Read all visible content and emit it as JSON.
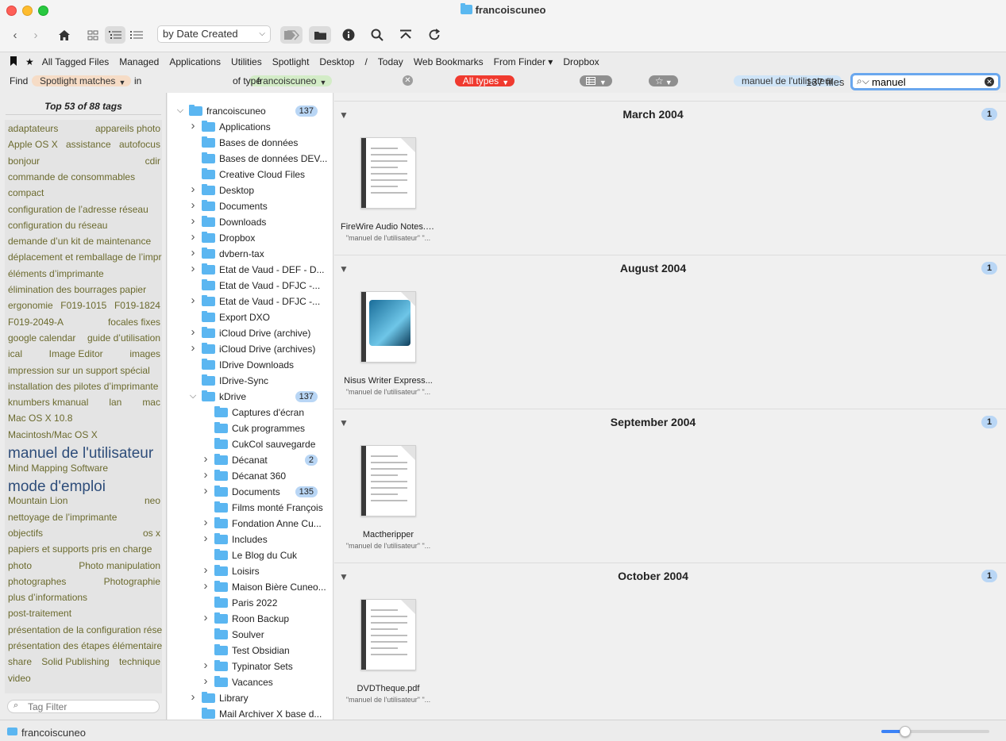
{
  "window": {
    "title": "francoiscuneo"
  },
  "toolbar": {
    "sort_label": "by Date Created",
    "icons": [
      "back-icon",
      "forward-icon",
      "home-icon",
      "grid-view-icon",
      "list-view-icon",
      "compact-list-icon",
      "tag-icon",
      "folder-icon",
      "info-icon",
      "search-icon",
      "go-top-icon",
      "refresh-icon"
    ]
  },
  "favorites": [
    "All Tagged Files",
    "Managed",
    "Applications",
    "Utilities",
    "Spotlight",
    "Desktop",
    "/",
    "Today",
    "Web Bookmarks",
    "From Finder ▾",
    "Dropbox"
  ],
  "findbar": {
    "find_label": "Find",
    "mode": "Spotlight matches",
    "in_label": "in",
    "location": "francoiscuneo",
    "type_label": "of type",
    "types": "All types",
    "tag_chip": "manuel de l'utilisateur",
    "count": "137 files"
  },
  "search": {
    "value": "manuel"
  },
  "tags": {
    "header": "Top 53 of 88 tags",
    "rows": [
      [
        "adaptateurs",
        "appareils photo"
      ],
      [
        "Apple OS X",
        "assistance",
        "autofocus"
      ],
      [
        "bonjour",
        "cdir"
      ],
      [
        "commande de consommables"
      ],
      [
        "compact"
      ],
      [
        "configuration de l’adresse réseau"
      ],
      [
        "configuration du réseau"
      ],
      [
        "demande d’un kit de maintenance"
      ],
      [
        "déplacement et remballage de l’imprimante"
      ],
      [
        "éléments d’imprimante"
      ],
      [
        "élimination des bourrages papier"
      ],
      [
        "ergonomie",
        "F019-1015",
        "F019-1824"
      ],
      [
        "F019-2049-A",
        "focales fixes"
      ],
      [
        "google calendar",
        "guide d’utilisation"
      ],
      [
        "ical",
        "Image Editor",
        "images"
      ],
      [
        "impression sur un support spécial"
      ],
      [
        "installation des pilotes d’imprimante"
      ],
      [
        "knumbers kmanual",
        "lan",
        "mac"
      ],
      [
        "Mac OS X 10.8"
      ],
      [
        "Macintosh/Mac OS X"
      ],
      [
        "manuel de l'utilisateur"
      ],
      [
        "Mind Mapping Software"
      ],
      [
        "mode d'emploi"
      ],
      [
        "Mountain Lion",
        "neo"
      ],
      [
        "nettoyage de l’imprimante"
      ],
      [
        "objectifs",
        "os x"
      ],
      [
        "papiers et supports pris en charge"
      ],
      [
        "photo",
        "Photo manipulation"
      ],
      [
        "photographes",
        "Photographie"
      ],
      [
        "plus d’informations"
      ],
      [
        "post-traitement"
      ],
      [
        "présentation de la configuration réseau"
      ],
      [
        "présentation des étapes élémentaires"
      ],
      [
        "share",
        "Solid Publishing",
        "technique"
      ],
      [
        "video"
      ]
    ],
    "filter_placeholder": "Tag Filter"
  },
  "tree": [
    {
      "label": "francoiscuneo",
      "level": 0,
      "disc": "down",
      "badge": "137"
    },
    {
      "label": "Applications",
      "level": 1,
      "disc": "right"
    },
    {
      "label": "Bases de données",
      "level": 1,
      "disc": ""
    },
    {
      "label": "Bases de données DEV...",
      "level": 1,
      "disc": ""
    },
    {
      "label": "Creative Cloud Files",
      "level": 1,
      "disc": ""
    },
    {
      "label": "Desktop",
      "level": 1,
      "disc": "right"
    },
    {
      "label": "Documents",
      "level": 1,
      "disc": "right"
    },
    {
      "label": "Downloads",
      "level": 1,
      "disc": "right"
    },
    {
      "label": "Dropbox",
      "level": 1,
      "disc": "right"
    },
    {
      "label": "dvbern-tax",
      "level": 1,
      "disc": "right"
    },
    {
      "label": "Etat de Vaud - DEF - D...",
      "level": 1,
      "disc": "right"
    },
    {
      "label": "Etat de Vaud - DFJC -...",
      "level": 1,
      "disc": ""
    },
    {
      "label": "Etat de Vaud - DFJC -...",
      "level": 1,
      "disc": "right"
    },
    {
      "label": "Export DXO",
      "level": 1,
      "disc": ""
    },
    {
      "label": "iCloud Drive (archive)",
      "level": 1,
      "disc": "right"
    },
    {
      "label": "iCloud Drive (archives)",
      "level": 1,
      "disc": "right"
    },
    {
      "label": "IDrive Downloads",
      "level": 1,
      "disc": ""
    },
    {
      "label": "IDrive-Sync",
      "level": 1,
      "disc": ""
    },
    {
      "label": "kDrive",
      "level": 1,
      "disc": "down",
      "badge": "137"
    },
    {
      "label": "Captures d'écran",
      "level": 2,
      "disc": ""
    },
    {
      "label": "Cuk programmes",
      "level": 2,
      "disc": ""
    },
    {
      "label": "CukCol sauvegarde",
      "level": 2,
      "disc": ""
    },
    {
      "label": "Décanat",
      "level": 2,
      "disc": "right",
      "badge": "2"
    },
    {
      "label": "Décanat 360",
      "level": 2,
      "disc": "right"
    },
    {
      "label": "Documents",
      "level": 2,
      "disc": "right",
      "badge": "135"
    },
    {
      "label": "Films monté François",
      "level": 2,
      "disc": ""
    },
    {
      "label": "Fondation Anne Cu...",
      "level": 2,
      "disc": "right"
    },
    {
      "label": "Includes",
      "level": 2,
      "disc": "right"
    },
    {
      "label": "Le Blog du Cuk",
      "level": 2,
      "disc": ""
    },
    {
      "label": "Loisirs",
      "level": 2,
      "disc": "right"
    },
    {
      "label": "Maison Bière Cuneo...",
      "level": 2,
      "disc": "right"
    },
    {
      "label": "Paris 2022",
      "level": 2,
      "disc": ""
    },
    {
      "label": "Roon Backup",
      "level": 2,
      "disc": "right"
    },
    {
      "label": "Soulver",
      "level": 2,
      "disc": ""
    },
    {
      "label": "Test Obsidian",
      "level": 2,
      "disc": ""
    },
    {
      "label": "Typinator Sets",
      "level": 2,
      "disc": "right"
    },
    {
      "label": "Vacances",
      "level": 2,
      "disc": "right"
    },
    {
      "label": "Library",
      "level": 1,
      "disc": "right"
    },
    {
      "label": "Mail Archiver X base d...",
      "level": 1,
      "disc": ""
    }
  ],
  "sections": [
    {
      "title": "March 2004",
      "count": "1",
      "file": "FireWire Audio Notes.pdf",
      "note": "\"manuel de l'utilisateur\" \"...",
      "thumb": "doc"
    },
    {
      "title": "August 2004",
      "count": "1",
      "file": "Nisus Writer Express...",
      "note": "\"manuel de l'utilisateur\" \"...",
      "thumb": "art"
    },
    {
      "title": "September 2004",
      "count": "1",
      "file": "Mactheripper",
      "note": "\"manuel de l'utilisateur\" \"...",
      "thumb": "doc"
    },
    {
      "title": "October 2004",
      "count": "1",
      "file": "DVDTheque.pdf",
      "note": "\"manuel de l'utilisateur\" \"...",
      "thumb": "doc"
    }
  ],
  "status": {
    "location": "francoiscuneo",
    "zoom": 0.22
  }
}
